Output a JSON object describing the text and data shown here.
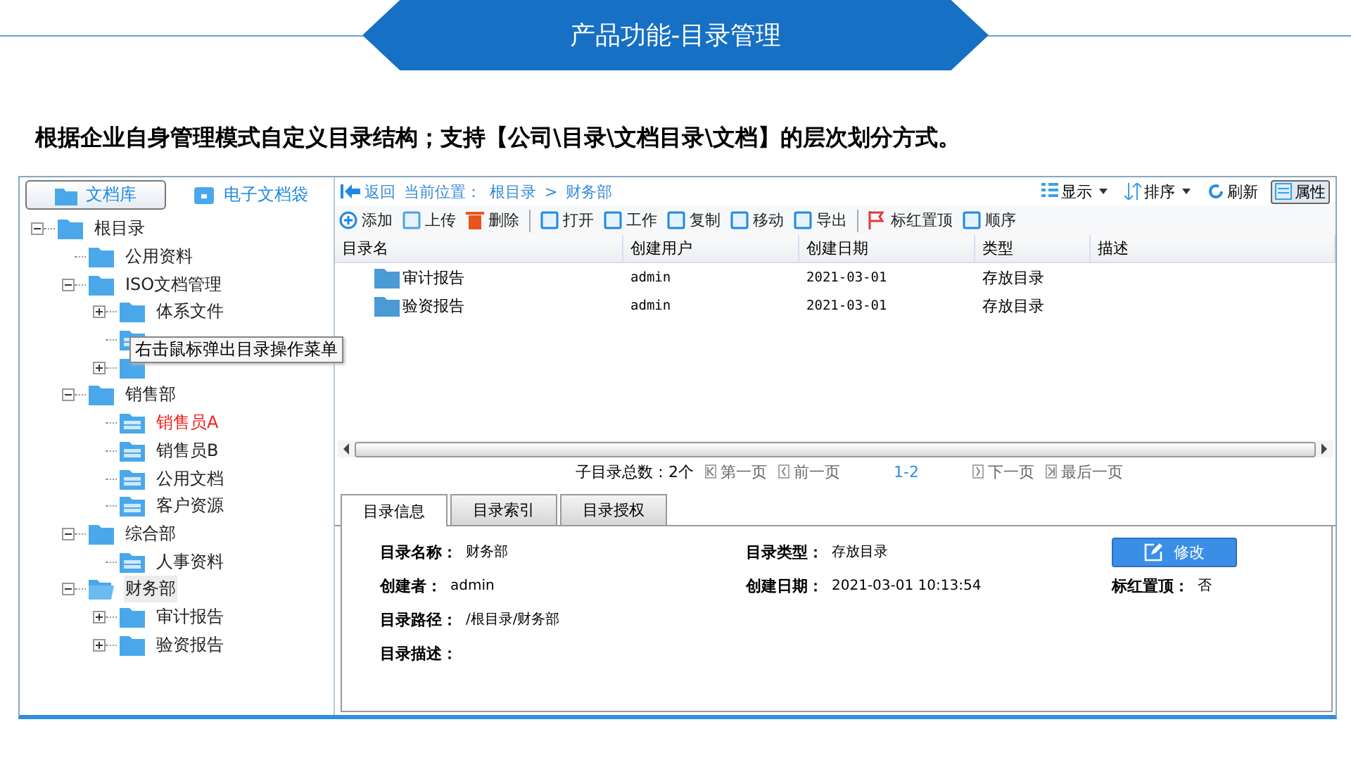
{
  "slide": {
    "title": "产品功能-目录管理",
    "subtitle": "根据企业自身管理模式自定义目录结构；支持【公司\\目录\\文档目录\\文档】的层次划分方式。"
  },
  "left_tabs": [
    {
      "label": "文档库",
      "selected": true
    },
    {
      "label": "电子文档袋",
      "selected": false
    }
  ],
  "tree": [
    {
      "label": "根目录",
      "kind": "folder",
      "expanded": true,
      "selected": false,
      "marked": false,
      "children": [
        {
          "label": "公用资料",
          "kind": "folder",
          "selected": false,
          "marked": false
        },
        {
          "label": "ISO文档管理",
          "kind": "folder",
          "expanded": true,
          "selected": false,
          "marked": false,
          "children": [
            {
              "label": "体系文件",
              "kind": "folder",
              "expanded": false,
              "selected": false,
              "marked": false
            },
            {
              "kind": "doc-folder"
            },
            {
              "kind": "folder",
              "expanded": false
            }
          ]
        },
        {
          "label": "销售部",
          "kind": "folder",
          "expanded": true,
          "selected": false,
          "marked": false,
          "children": [
            {
              "label": "销售员A",
              "kind": "doc-folder",
              "selected": false,
              "marked": true
            },
            {
              "label": "销售员B",
              "kind": "doc-folder",
              "selected": false,
              "marked": false
            },
            {
              "label": "公用文档",
              "kind": "doc-folder",
              "selected": false,
              "marked": false
            },
            {
              "label": "客户资源",
              "kind": "doc-folder",
              "selected": false,
              "marked": false
            }
          ]
        },
        {
          "label": "综合部",
          "kind": "folder",
          "expanded": true,
          "selected": false,
          "marked": false,
          "children": [
            {
              "label": "人事资料",
              "kind": "doc-folder",
              "selected": false,
              "marked": false
            }
          ]
        },
        {
          "label": "财务部",
          "kind": "folder",
          "expanded": true,
          "selected": true,
          "marked": false,
          "children": [
            {
              "label": "审计报告",
              "kind": "folder",
              "expanded": false,
              "selected": false,
              "marked": false
            },
            {
              "label": "验资报告",
              "kind": "folder",
              "expanded": false,
              "selected": false,
              "marked": false
            }
          ]
        }
      ]
    }
  ],
  "tooltip": "右击鼠标弹出目录操作菜单",
  "nav": {
    "back": "返回",
    "location_label": "当前位置：",
    "path": [
      "根目录",
      "财务部"
    ],
    "separator": ">"
  },
  "view_tools": [
    {
      "label": "显示",
      "dropdown": true,
      "selected": false
    },
    {
      "label": "排序",
      "dropdown": true,
      "selected": false
    },
    {
      "label": "刷新",
      "dropdown": false,
      "selected": false
    },
    {
      "label": "属性",
      "dropdown": false,
      "selected": true
    }
  ],
  "toolbar": [
    [
      "添加",
      "上传",
      "删除"
    ],
    [
      "打开",
      "工作",
      "复制",
      "移动",
      "导出"
    ],
    [
      "标红置顶",
      "顺序"
    ]
  ],
  "table": {
    "columns": [
      "目录名",
      "创建用户",
      "创建日期",
      "类型",
      "描述"
    ],
    "rows": [
      [
        "审计报告",
        "admin",
        "2021-03-01",
        "存放目录"
      ],
      [
        "验资报告",
        "admin",
        "2021-03-01",
        "存放目录"
      ]
    ]
  },
  "pager": {
    "total": "子目录总数：2个",
    "first": "第一页",
    "prev": "前一页",
    "range": "1-2",
    "next": "下一页",
    "last": "最后一页"
  },
  "detail_tabs": [
    {
      "label": "目录信息",
      "selected": true
    },
    {
      "label": "目录索引",
      "selected": false
    },
    {
      "label": "目录授权",
      "selected": false
    }
  ],
  "details": [
    [
      {
        "label": "目录名称：",
        "value": "财务部"
      },
      {
        "label": "目录类型：",
        "value": "存放目录"
      }
    ],
    [
      {
        "label": "创建者：",
        "value": "admin"
      },
      {
        "label": "创建日期：",
        "value": "2021-03-01 10:13:54"
      },
      {
        "label": "标红置顶：",
        "value": "否"
      }
    ],
    [
      {
        "label": "目录路径：",
        "value": "/根目录/财务部"
      }
    ],
    [
      {
        "label": "目录描述："
      }
    ]
  ],
  "edit_button": "修改"
}
